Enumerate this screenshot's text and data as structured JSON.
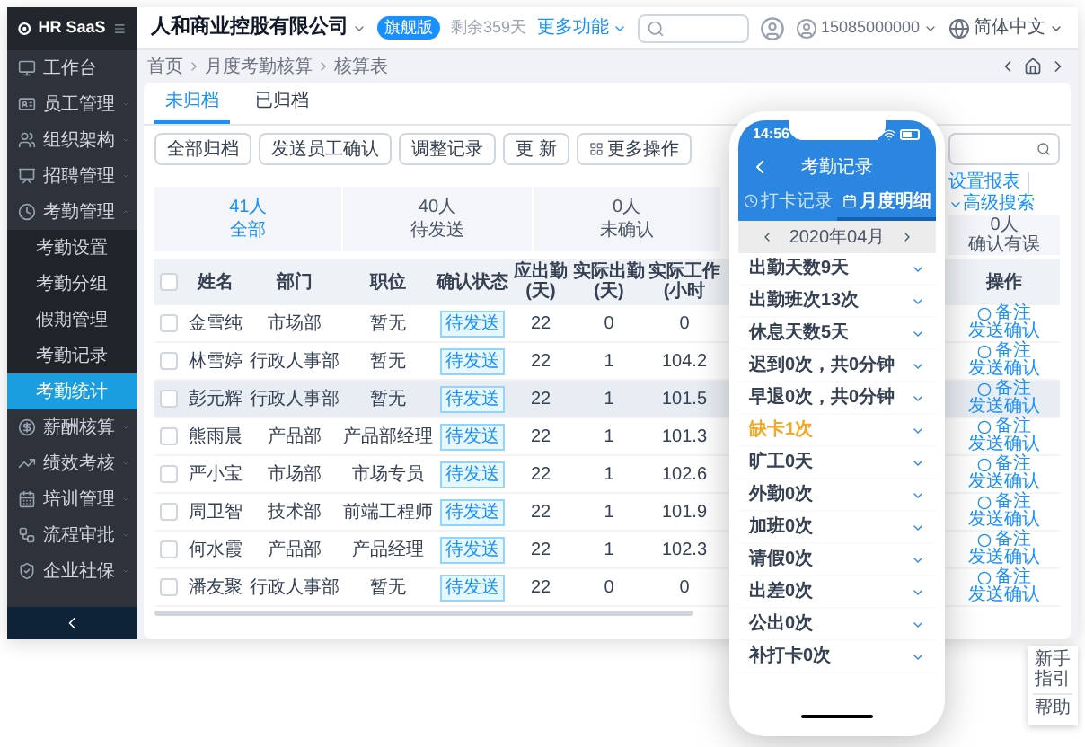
{
  "sidebar": {
    "logo": "HR SaaS",
    "items": [
      {
        "label": "工作台",
        "selected": false
      },
      {
        "label": "员工管理",
        "selected": false,
        "expanded": false
      },
      {
        "label": "组织架构",
        "selected": false,
        "expanded": false
      },
      {
        "label": "招聘管理",
        "selected": false,
        "expanded": false
      },
      {
        "label": "考勤管理",
        "selected": false,
        "expanded": true,
        "children": [
          {
            "label": "考勤设置",
            "selected": false
          },
          {
            "label": "考勤分组",
            "selected": false
          },
          {
            "label": "假期管理",
            "selected": false
          },
          {
            "label": "考勤记录",
            "selected": false
          },
          {
            "label": "考勤统计",
            "selected": true
          }
        ]
      },
      {
        "label": "薪酬核算",
        "selected": false,
        "expanded": false
      },
      {
        "label": "绩效考核",
        "selected": false,
        "expanded": false
      },
      {
        "label": "培训管理",
        "selected": false,
        "expanded": false
      },
      {
        "label": "流程审批",
        "selected": false,
        "expanded": false
      },
      {
        "label": "企业社保",
        "selected": false,
        "expanded": false
      }
    ]
  },
  "top_bar": {
    "company": "人和商业控股有限公司",
    "plan": "旗舰版",
    "remaining": "剩余359天",
    "more": "更多功能",
    "user": "15085000000",
    "language": "简体中文"
  },
  "breadcrumb": [
    "首页",
    "月度考勤核算",
    "核算表"
  ],
  "tabs": [
    {
      "label": "未归档",
      "selected": true
    },
    {
      "label": "已归档",
      "selected": false
    }
  ],
  "toolbar": [
    {
      "label": "全部归档",
      "kind": "plain"
    },
    {
      "label": "发送员工确认",
      "kind": "plain"
    },
    {
      "label": "调整记录",
      "kind": "plain"
    },
    {
      "label": "更 新",
      "kind": "plain"
    },
    {
      "label": "更多操作",
      "kind": "menu"
    }
  ],
  "links": [
    "设置报表",
    "高级搜索"
  ],
  "stats": [
    {
      "count": "41人",
      "label": "全部",
      "selected": true
    },
    {
      "count": "40人",
      "label": "待发送",
      "selected": false
    },
    {
      "count": "0人",
      "label": "未确认",
      "selected": false
    },
    {
      "count": "0人",
      "label": "确认有误",
      "selected": false
    }
  ],
  "table": {
    "all_checked": false,
    "columns": [
      "姓名",
      "部门",
      "职位",
      "确认状态",
      "应出勤(天)",
      "实际出勤(天)",
      "实际工作(小时",
      "操作"
    ],
    "rows": [
      {
        "checked": false,
        "highlighted": false,
        "name": "金雪纯",
        "dept": "市场部",
        "title": "暂无",
        "status": "待发送",
        "due": "22",
        "actual": "0",
        "hours": "0",
        "actions": [
          "备注",
          "发送确认"
        ]
      },
      {
        "checked": false,
        "highlighted": false,
        "name": "林雪婷",
        "dept": "行政人事部",
        "title": "暂无",
        "status": "待发送",
        "due": "22",
        "actual": "1",
        "hours": "104.2",
        "actions": [
          "备注",
          "发送确认"
        ]
      },
      {
        "checked": false,
        "highlighted": true,
        "name": "彭元辉",
        "dept": "行政人事部",
        "title": "暂无",
        "status": "待发送",
        "due": "22",
        "actual": "1",
        "hours": "101.5",
        "actions": [
          "备注",
          "发送确认"
        ]
      },
      {
        "checked": false,
        "highlighted": false,
        "name": "熊雨晨",
        "dept": "产品部",
        "title": "产品部经理",
        "status": "待发送",
        "due": "22",
        "actual": "1",
        "hours": "101.3",
        "actions": [
          "备注",
          "发送确认"
        ]
      },
      {
        "checked": false,
        "highlighted": false,
        "name": "严小宝",
        "dept": "市场部",
        "title": "市场专员",
        "status": "待发送",
        "due": "22",
        "actual": "1",
        "hours": "102.6",
        "actions": [
          "备注",
          "发送确认"
        ]
      },
      {
        "checked": false,
        "highlighted": false,
        "name": "周卫智",
        "dept": "技术部",
        "title": "前端工程师",
        "status": "待发送",
        "due": "22",
        "actual": "1",
        "hours": "101.9",
        "actions": [
          "备注",
          "发送确认"
        ]
      },
      {
        "checked": false,
        "highlighted": false,
        "name": "何水霞",
        "dept": "产品部",
        "title": "产品经理",
        "status": "待发送",
        "due": "22",
        "actual": "1",
        "hours": "102.3",
        "actions": [
          "备注",
          "发送确认"
        ]
      },
      {
        "checked": false,
        "highlighted": false,
        "name": "潘友聚",
        "dept": "行政人事部",
        "title": "暂无",
        "status": "待发送",
        "due": "22",
        "actual": "0",
        "hours": "0",
        "actions": [
          "备注",
          "发送确认"
        ]
      }
    ]
  },
  "help": [
    "新手指引",
    "帮助"
  ],
  "phone": {
    "time": "14:56",
    "title": "考勤记录",
    "tabs": [
      {
        "label": "打卡记录",
        "selected": false
      },
      {
        "label": "月度明细",
        "selected": true
      }
    ],
    "month": "2020年04月",
    "items": [
      {
        "text": "出勤天数9天",
        "warning": false
      },
      {
        "text": "出勤班次13次",
        "warning": false
      },
      {
        "text": "休息天数5天",
        "warning": false
      },
      {
        "text": "迟到0次，共0分钟",
        "warning": false
      },
      {
        "text": "早退0次，共0分钟",
        "warning": false
      },
      {
        "text": "缺卡1次",
        "warning": true
      },
      {
        "text": "旷工0天",
        "warning": false
      },
      {
        "text": "外勤0次",
        "warning": false
      },
      {
        "text": "加班0次",
        "warning": false
      },
      {
        "text": "请假0次",
        "warning": false
      },
      {
        "text": "出差0次",
        "warning": false
      },
      {
        "text": "公出0次",
        "warning": false
      },
      {
        "text": "补打卡0次",
        "warning": false
      }
    ]
  }
}
